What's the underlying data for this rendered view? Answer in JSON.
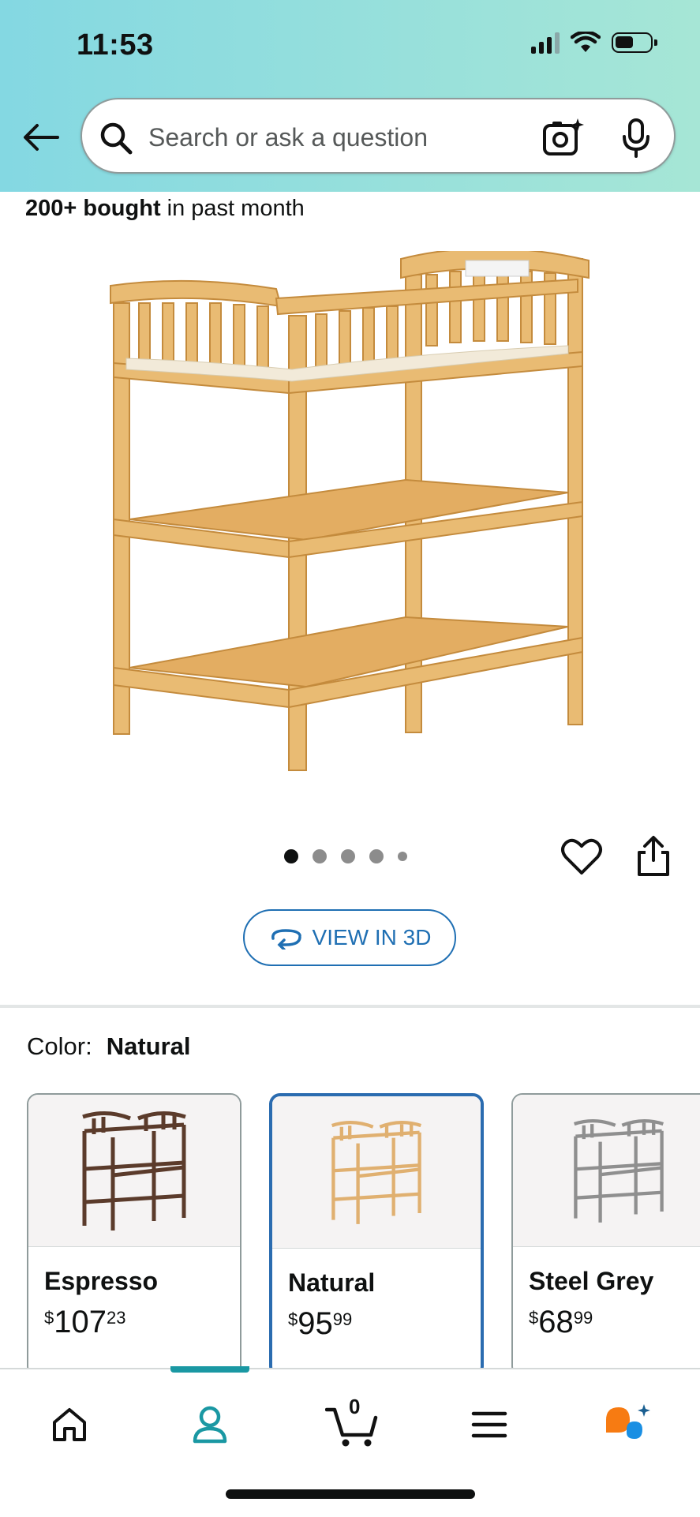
{
  "status_bar": {
    "time": "11:53"
  },
  "search": {
    "placeholder": "Search or ask a question"
  },
  "social_proof": {
    "count": "200+ bought",
    "suffix": " in past month"
  },
  "gallery": {
    "image_count": 5,
    "active_index": 0
  },
  "view3d": {
    "label": "VIEW IN 3D"
  },
  "color": {
    "label": "Color:",
    "selected": "Natural",
    "options": [
      {
        "name": "Espresso",
        "currency": "$",
        "whole": "107",
        "fraction": "23",
        "tint": "#5b3b2b"
      },
      {
        "name": "Natural",
        "currency": "$",
        "whole": "95",
        "fraction": "99",
        "tint": "#e0b070"
      },
      {
        "name": "Steel Grey",
        "currency": "$",
        "whole": "68",
        "fraction": "99",
        "tint": "#8f8f8f"
      }
    ]
  },
  "bottom_nav": {
    "items": [
      "home-icon",
      "account-icon",
      "cart-icon",
      "menu-icon",
      "rufus-icon"
    ],
    "active": "account-icon",
    "cart_count": "0"
  },
  "colors": {
    "accent_blue": "#1f6fb3",
    "teal": "#1a98a3",
    "wood": "#e6b36a"
  }
}
